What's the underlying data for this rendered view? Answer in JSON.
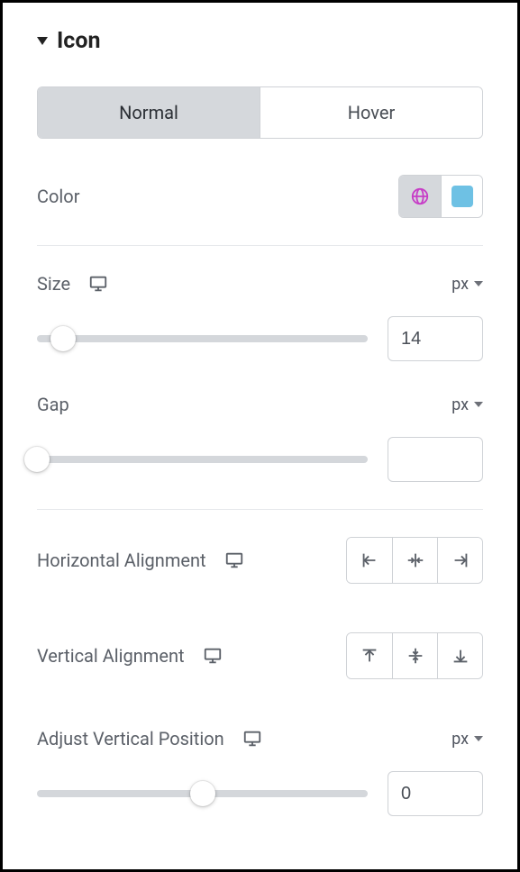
{
  "section": {
    "title": "Icon"
  },
  "tabs": {
    "normal": "Normal",
    "hover": "Hover",
    "active": "normal"
  },
  "color": {
    "label": "Color",
    "swatch_hex": "#6ec1e4",
    "global_icon_color": "#c73dc7"
  },
  "size": {
    "label": "Size",
    "unit": "px",
    "value": "14",
    "slider_pos_percent": 8
  },
  "gap": {
    "label": "Gap",
    "unit": "px",
    "value": "",
    "slider_pos_percent": 0
  },
  "halign": {
    "label": "Horizontal Alignment"
  },
  "valign": {
    "label": "Vertical Alignment"
  },
  "vpos": {
    "label": "Adjust Vertical Position",
    "unit": "px",
    "value": "0",
    "slider_pos_percent": 50
  }
}
